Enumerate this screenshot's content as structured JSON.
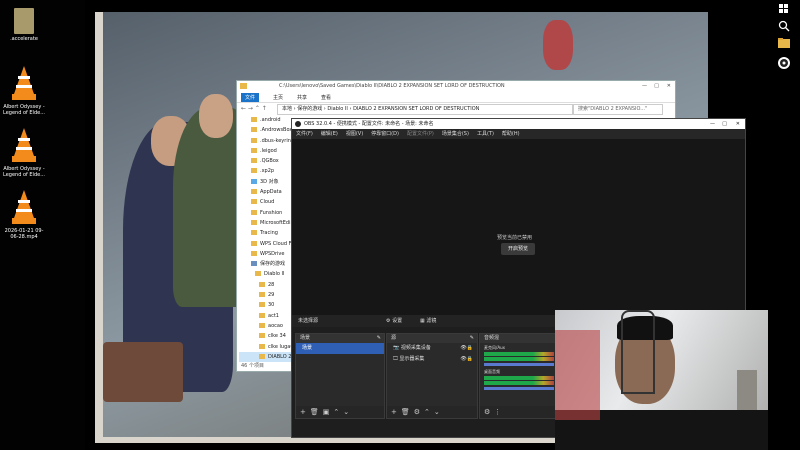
{
  "desktop": {
    "icons": [
      {
        "label": ".accelerate",
        "type": "folder"
      },
      {
        "label": "Albert Odyssey - Legend of Elde...",
        "type": "vlc"
      },
      {
        "label": "Albert Odyssey - Legend of Elde...",
        "type": "vlc"
      },
      {
        "label": "2026-01-21 09-06-28.mp4",
        "type": "vlc"
      }
    ]
  },
  "taskbar": {
    "icons": [
      "windows-icon",
      "search-icon",
      "file-explorer-icon",
      "obs-icon"
    ]
  },
  "explorer": {
    "title_path": "C:\\Users\\lenovo\\Saved Games\\Diablo II\\DIABLO 2 EXPANSION SET LORD OF DESTRUCTION",
    "ribbon": [
      "文件",
      "主页",
      "共享",
      "查看"
    ],
    "address_parts": [
      "本地",
      "保存的游戏",
      "Diablo II",
      "DIABLO 2 EXPANSION SET LORD OF DESTRUCTION"
    ],
    "search_placeholder": "搜索\"DIABLO 2 EXPANSIO...\"",
    "nav_items": [
      ".android",
      ".AndrowsBox",
      ".dbus-keyrin",
      ".leigod",
      ".QGBox",
      ".xp2p",
      "3D 对象",
      "AppData",
      "Cloud",
      "Funshion",
      "MicrosoftEdi",
      "Tracing",
      "WPS Cloud F",
      "WPSDrive",
      "保存的游戏",
      "Diablo II",
      "28",
      "29",
      "30",
      "act1",
      "aocao",
      "clke 34",
      "clke lugau",
      "DIABLO 2"
    ],
    "status": "46 个项目"
  },
  "obs": {
    "title": "OBS 32.0.4 - 便携模式 - 配置文件: 未命名 - 场景: 未命名",
    "menu": [
      "文件(F)",
      "编辑(E)",
      "视图(V)",
      "停靠窗口(D)",
      "配置文件(P)",
      "场景集合(S)",
      "工具(T)",
      "帮助(H)"
    ],
    "preview_message": "预览当前已禁用",
    "preview_button": "开启预览",
    "bar": {
      "scene_selected": "未选择源",
      "settings": "设置",
      "filters": "滤镜"
    },
    "scenes": {
      "header": "场景",
      "items": [
        "场景"
      ]
    },
    "sources": {
      "header": "源",
      "items": [
        "视频采集设备",
        "显示器采集"
      ]
    },
    "mixer": {
      "header": "音频混",
      "tracks": [
        "麦克风/Aux",
        "桌面音频"
      ]
    }
  }
}
